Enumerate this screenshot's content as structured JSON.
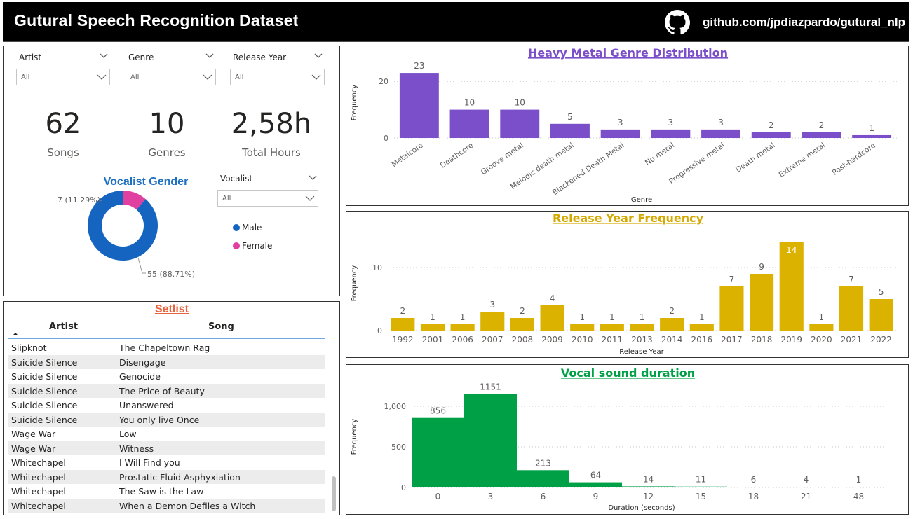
{
  "header": {
    "title": "Gutural Speech Recognition Dataset",
    "link": "github.com/jpdiazpardo/gutural_nlp"
  },
  "filters": {
    "artist": {
      "label": "Artist",
      "value": "All"
    },
    "genre": {
      "label": "Genre",
      "value": "All"
    },
    "release_year": {
      "label": "Release Year",
      "value": "All"
    },
    "vocalist": {
      "label": "Vocalist",
      "value": "All"
    }
  },
  "kpis": {
    "songs": {
      "value": "62",
      "label": "Songs"
    },
    "genres": {
      "value": "10",
      "label": "Genres"
    },
    "hours": {
      "value": "2,58h",
      "label": "Total Hours"
    }
  },
  "vocalist_gender": {
    "title": "Vocalist Gender",
    "slices": [
      {
        "name": "Male",
        "value": 55,
        "label": "55 (88.71%)",
        "color": "#1565c0"
      },
      {
        "name": "Female",
        "value": 7,
        "label": "7 (11.29%)",
        "color": "#e040a0"
      }
    ]
  },
  "setlist": {
    "title": "Setlist",
    "columns": [
      "Artist",
      "Song"
    ],
    "rows": [
      [
        "Slipknot",
        "The Chapeltown Rag"
      ],
      [
        "Suicide Silence",
        "Disengage"
      ],
      [
        "Suicide Silence",
        "Genocide"
      ],
      [
        "Suicide Silence",
        "The Price of Beauty"
      ],
      [
        "Suicide Silence",
        "Unanswered"
      ],
      [
        "Suicide Silence",
        "You only live Once"
      ],
      [
        "Wage War",
        "Low"
      ],
      [
        "Wage War",
        "Witness"
      ],
      [
        "Whitechapel",
        "I Will Find you"
      ],
      [
        "Whitechapel",
        "Prostatic Fluid Asphyxiation"
      ],
      [
        "Whitechapel",
        "The Saw is the Law"
      ],
      [
        "Whitechapel",
        "When a Demon Defiles a Witch"
      ]
    ]
  },
  "chart_data": [
    {
      "type": "bar",
      "title": "Heavy Metal Genre Distribution",
      "xlabel": "Genre",
      "ylabel": "Frequency",
      "color": "#7b4fc9",
      "title_color": "#7b4fc9",
      "ylim": [
        0,
        25
      ],
      "yticks": [
        0,
        20
      ],
      "categories": [
        "Metalcore",
        "Deathcore",
        "Groove metal",
        "Melodic death metal",
        "Blackened Death Metal",
        "Nu metal",
        "Progressive metal",
        "Death metal",
        "Extreme metal",
        "Post-hardcore"
      ],
      "values": [
        23,
        10,
        10,
        5,
        3,
        3,
        3,
        2,
        2,
        1
      ]
    },
    {
      "type": "bar",
      "title": "Release Year Frequency",
      "xlabel": "Release Year",
      "ylabel": "Frequency",
      "color": "#dbb200",
      "title_color": "#d4aa00",
      "ylim": [
        0,
        15
      ],
      "yticks": [
        0,
        10
      ],
      "categories": [
        "1992",
        "2001",
        "2006",
        "2007",
        "2008",
        "2009",
        "2010",
        "2011",
        "2013",
        "2014",
        "2016",
        "2017",
        "2018",
        "2019",
        "2020",
        "2021",
        "2022"
      ],
      "values": [
        2,
        1,
        1,
        3,
        2,
        4,
        1,
        1,
        1,
        2,
        1,
        7,
        9,
        14,
        1,
        7,
        5
      ]
    },
    {
      "type": "bar",
      "title": "Vocal sound duration",
      "xlabel": "Duration (seconds)",
      "ylabel": "Frequency",
      "color": "#00a046",
      "title_color": "#00a046",
      "ylim": [
        0,
        1250
      ],
      "yticks": [
        0,
        500,
        1000
      ],
      "ytick_labels": [
        "0",
        "500",
        "1,000"
      ],
      "categories": [
        "0",
        "3",
        "6",
        "9",
        "12",
        "15",
        "18",
        "21",
        "48"
      ],
      "values": [
        856,
        1151,
        213,
        64,
        14,
        11,
        6,
        4,
        1
      ]
    }
  ]
}
